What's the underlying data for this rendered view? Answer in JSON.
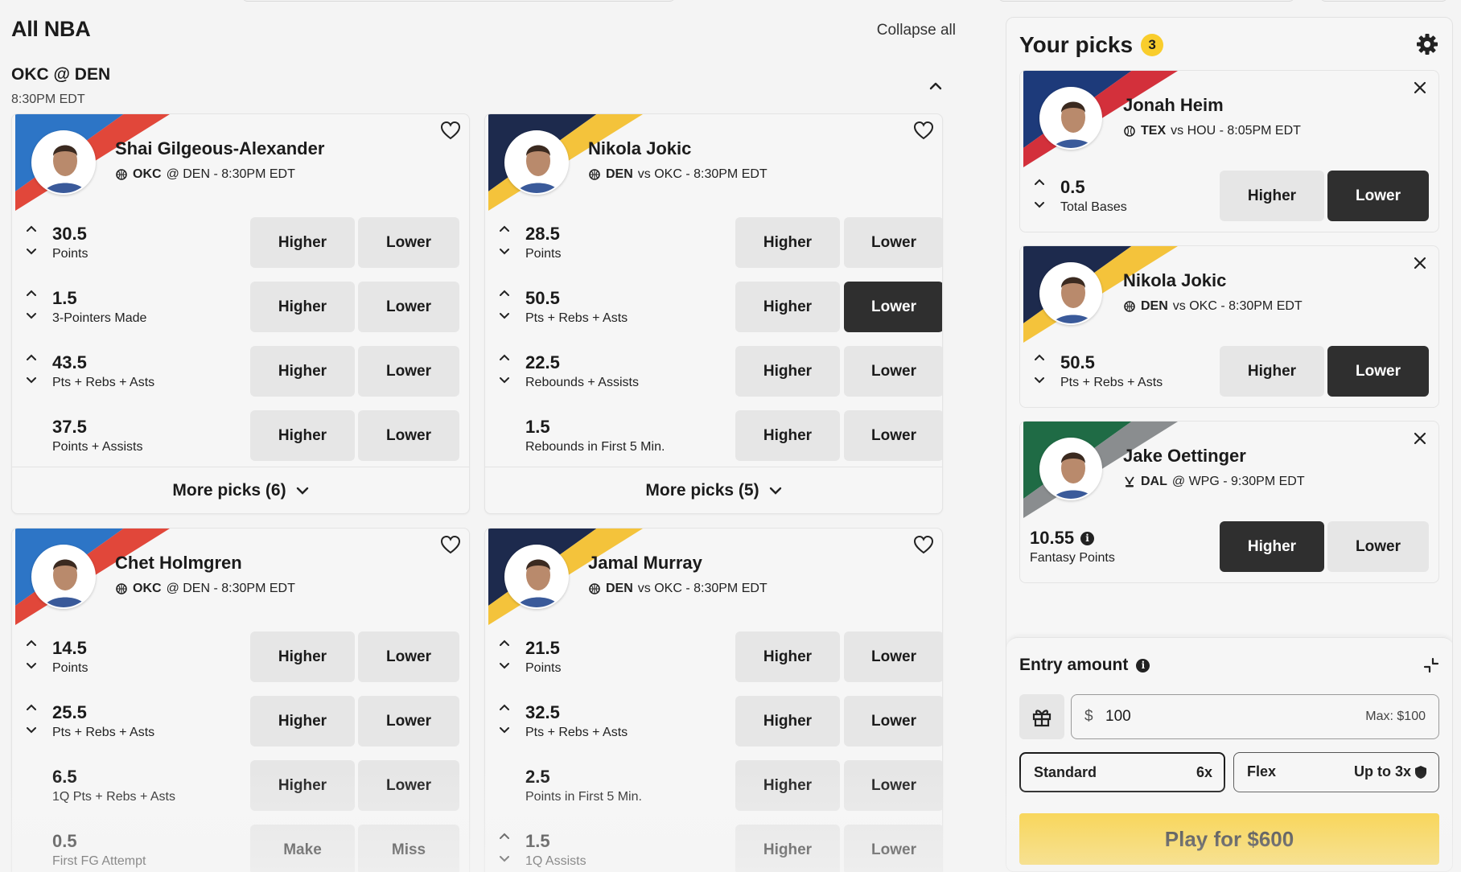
{
  "main": {
    "title": "All NBA",
    "collapse_all": "Collapse all",
    "game": "OKC @ DEN",
    "game_time": "8:30PM EDT"
  },
  "cards": [
    {
      "name": "Shai Gilgeous-Alexander",
      "team": "OKC",
      "matchup": "@ DEN - 8:30PM EDT",
      "team_colors": [
        "#2d75c6",
        "#e1473a"
      ],
      "rows": [
        {
          "line": "30.5",
          "stat": "Points",
          "left": "Higher",
          "right": "Lower",
          "arrows": true,
          "selected": ""
        },
        {
          "line": "1.5",
          "stat": "3-Pointers Made",
          "left": "Higher",
          "right": "Lower",
          "arrows": true,
          "selected": ""
        },
        {
          "line": "43.5",
          "stat": "Pts + Rebs + Asts",
          "left": "Higher",
          "right": "Lower",
          "arrows": true,
          "selected": ""
        },
        {
          "line": "37.5",
          "stat": "Points + Assists",
          "left": "Higher",
          "right": "Lower",
          "arrows": false,
          "selected": ""
        }
      ],
      "more": "More picks (6)"
    },
    {
      "name": "Nikola Jokic",
      "team": "DEN",
      "matchup": "vs OKC - 8:30PM EDT",
      "team_colors": [
        "#1d2a4d",
        "#f4c33b"
      ],
      "rows": [
        {
          "line": "28.5",
          "stat": "Points",
          "left": "Higher",
          "right": "Lower",
          "arrows": true,
          "selected": ""
        },
        {
          "line": "50.5",
          "stat": "Pts + Rebs + Asts",
          "left": "Higher",
          "right": "Lower",
          "arrows": true,
          "selected": "right"
        },
        {
          "line": "22.5",
          "stat": "Rebounds + Assists",
          "left": "Higher",
          "right": "Lower",
          "arrows": true,
          "selected": ""
        },
        {
          "line": "1.5",
          "stat": "Rebounds in First 5 Min.",
          "left": "Higher",
          "right": "Lower",
          "arrows": false,
          "selected": ""
        }
      ],
      "more": "More picks (5)"
    },
    {
      "name": "Chet Holmgren",
      "team": "OKC",
      "matchup": "@ DEN - 8:30PM EDT",
      "team_colors": [
        "#2d75c6",
        "#e1473a"
      ],
      "rows": [
        {
          "line": "14.5",
          "stat": "Points",
          "left": "Higher",
          "right": "Lower",
          "arrows": true,
          "selected": ""
        },
        {
          "line": "25.5",
          "stat": "Pts + Rebs + Asts",
          "left": "Higher",
          "right": "Lower",
          "arrows": true,
          "selected": ""
        },
        {
          "line": "6.5",
          "stat": "1Q Pts + Rebs + Asts",
          "left": "Higher",
          "right": "Lower",
          "arrows": false,
          "selected": ""
        },
        {
          "line": "0.5",
          "stat": "First FG Attempt",
          "left": "Make",
          "right": "Miss",
          "arrows": false,
          "selected": ""
        }
      ]
    },
    {
      "name": "Jamal Murray",
      "team": "DEN",
      "matchup": "vs OKC - 8:30PM EDT",
      "team_colors": [
        "#1d2a4d",
        "#f4c33b"
      ],
      "rows": [
        {
          "line": "21.5",
          "stat": "Points",
          "left": "Higher",
          "right": "Lower",
          "arrows": true,
          "selected": ""
        },
        {
          "line": "32.5",
          "stat": "Pts + Rebs + Asts",
          "left": "Higher",
          "right": "Lower",
          "arrows": true,
          "selected": ""
        },
        {
          "line": "2.5",
          "stat": "Points in First 5 Min.",
          "left": "Higher",
          "right": "Lower",
          "arrows": false,
          "selected": ""
        },
        {
          "line": "1.5",
          "stat": "1Q Assists",
          "left": "Higher",
          "right": "Lower",
          "arrows": true,
          "selected": ""
        }
      ]
    }
  ],
  "sidebar": {
    "title": "Your picks",
    "count": "3",
    "picks": [
      {
        "name": "Jonah Heim",
        "team": "TEX",
        "matchup": "vs HOU - 8:05PM EDT",
        "sport_icon": "baseball-icon",
        "team_colors": [
          "#1d3a7a",
          "#d3303b"
        ],
        "line": "0.5",
        "stat": "Total Bases",
        "left": "Higher",
        "right": "Lower",
        "selected": "right",
        "arrows": true,
        "info": false
      },
      {
        "name": "Nikola Jokic",
        "team": "DEN",
        "matchup": "vs OKC - 8:30PM EDT",
        "sport_icon": "basketball-icon",
        "team_colors": [
          "#1d2a4d",
          "#f4c33b"
        ],
        "line": "50.5",
        "stat": "Pts + Rebs + Asts",
        "left": "Higher",
        "right": "Lower",
        "selected": "right",
        "arrows": true,
        "info": false
      },
      {
        "name": "Jake Oettinger",
        "team": "DAL",
        "matchup": "@ WPG - 9:30PM EDT",
        "sport_icon": "hockey-icon",
        "team_colors": [
          "#1f6b45",
          "#8a8d8f"
        ],
        "line": "10.55",
        "stat": "Fantasy Points",
        "left": "Higher",
        "right": "Lower",
        "selected": "left",
        "arrows": false,
        "info": true
      }
    ]
  },
  "entry": {
    "title": "Entry amount",
    "currency": "$",
    "amount": "100",
    "max": "Max: $100",
    "standard_label": "Standard",
    "standard_mult": "6x",
    "flex_label": "Flex",
    "flex_mult": "Up to 3x",
    "play_label": "Play for $600"
  },
  "colors": {
    "accent": "#f9cd2c",
    "selected_button": "#2f2f2f",
    "button": "#e6e6e6"
  }
}
